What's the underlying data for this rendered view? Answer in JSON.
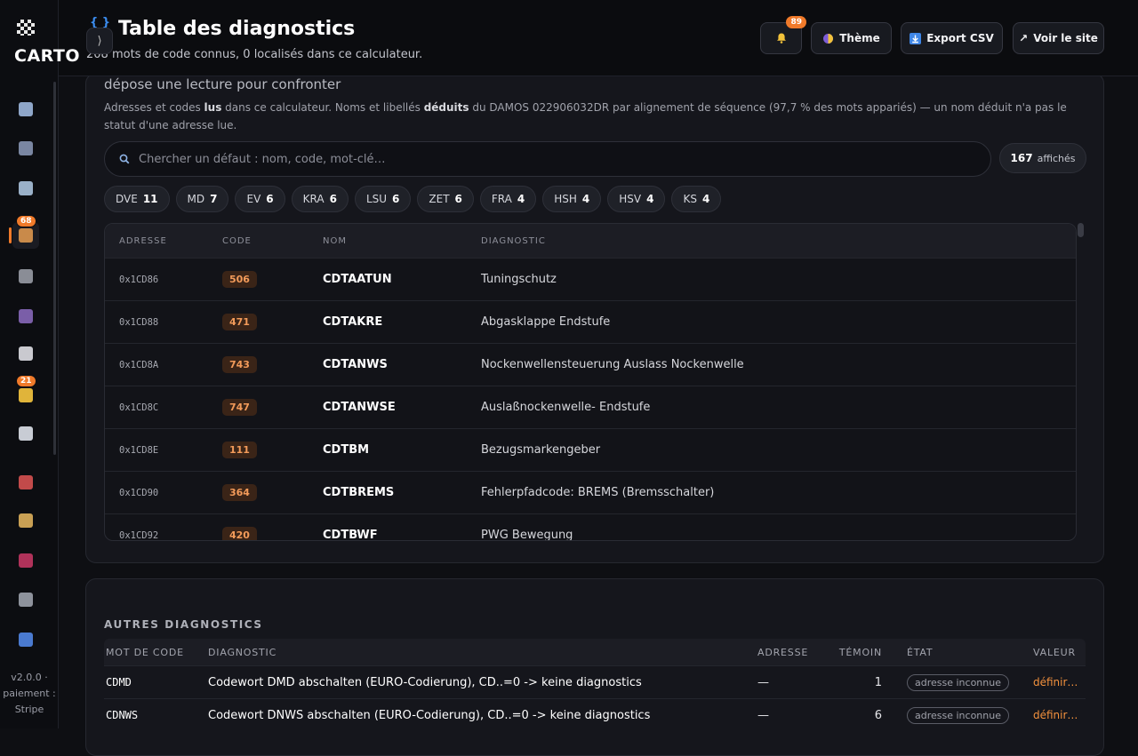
{
  "sidebar": {
    "brand": "CARTO",
    "version_text": "v2.0.0 · paiement : Stripe",
    "items": [
      {
        "icon": "bar-chart-icon",
        "color": "#8fa6c9"
      },
      {
        "icon": "tv-icon",
        "color": "#7a86a2"
      },
      {
        "icon": "trend-chart-icon",
        "color": "#9ab0c8"
      },
      {
        "icon": "package-icon",
        "color": "#c98a4a",
        "badge": "68",
        "active": true
      },
      {
        "icon": "plug-icon",
        "color": "#8a8d96"
      },
      {
        "icon": "users-icon",
        "color": "#7a5ea8"
      },
      {
        "icon": "chat-icon",
        "color": "#c9c9cf"
      },
      {
        "icon": "star-icon",
        "color": "#e0b43a",
        "badge": "21"
      },
      {
        "icon": "robot-icon",
        "color": "#c8ccd4"
      },
      {
        "icon": "car-icon",
        "color": "#c24a4a"
      },
      {
        "icon": "tag-icon",
        "color": "#c9a054"
      },
      {
        "icon": "ticket-icon",
        "color": "#b0325a"
      },
      {
        "icon": "building-icon",
        "color": "#8e929c"
      },
      {
        "icon": "shield-icon",
        "color": "#4a7ad0"
      }
    ]
  },
  "header": {
    "title": "Table des diagnostics",
    "subtitle": "208 mots de code connus, 0 localisés dans ce calculateur.",
    "notif_count": "89",
    "theme_label": "Thème",
    "export_label": "Export CSV",
    "site_label": "Voir le site"
  },
  "panel1": {
    "lead": "dépose une lecture pour confronter",
    "desc": {
      "p1": "Adresses et codes ",
      "b1": "lus",
      "p2": " dans ce calculateur. Noms et libellés ",
      "b2": "déduits",
      "p3": " du DAMOS 022906032DR par alignement de séquence (97,7 % des mots appariés) — un nom déduit n'a pas le statut d'une adresse lue."
    },
    "search_placeholder": "Chercher un défaut : nom, code, mot-clé…",
    "count_value": "167",
    "count_label": "affichés",
    "chips": [
      {
        "label": "DVE",
        "count": "11"
      },
      {
        "label": "MD",
        "count": "7"
      },
      {
        "label": "EV",
        "count": "6"
      },
      {
        "label": "KRA",
        "count": "6"
      },
      {
        "label": "LSU",
        "count": "6"
      },
      {
        "label": "ZET",
        "count": "6"
      },
      {
        "label": "FRA",
        "count": "4"
      },
      {
        "label": "HSH",
        "count": "4"
      },
      {
        "label": "HSV",
        "count": "4"
      },
      {
        "label": "KS",
        "count": "4"
      }
    ],
    "columns": [
      "ADRESSE",
      "CODE",
      "NOM",
      "DIAGNOSTIC"
    ],
    "rows": [
      {
        "adresse": "0x1CD86",
        "code": "506",
        "nom": "CDTAATUN",
        "diagnostic": "Tuningschutz"
      },
      {
        "adresse": "0x1CD88",
        "code": "471",
        "nom": "CDTAKRE",
        "diagnostic": "Abgasklappe Endstufe"
      },
      {
        "adresse": "0x1CD8A",
        "code": "743",
        "nom": "CDTANWS",
        "diagnostic": "Nockenwellensteuerung Auslass Nockenwelle"
      },
      {
        "adresse": "0x1CD8C",
        "code": "747",
        "nom": "CDTANWSE",
        "diagnostic": "Auslaßnockenwelle- Endstufe"
      },
      {
        "adresse": "0x1CD8E",
        "code": "111",
        "nom": "CDTBM",
        "diagnostic": "Bezugsmarkengeber"
      },
      {
        "adresse": "0x1CD90",
        "code": "364",
        "nom": "CDTBREMS",
        "diagnostic": "Fehlerpfadcode: BREMS (Bremsschalter)"
      },
      {
        "adresse": "0x1CD92",
        "code": "420",
        "nom": "CDTBWF",
        "diagnostic": "PWG Bewegung"
      }
    ]
  },
  "panel2": {
    "title": "AUTRES DIAGNOSTICS",
    "columns": [
      "MOT DE CODE",
      "DIAGNOSTIC",
      "ADRESSE",
      "TÉMOIN",
      "ÉTAT",
      "VALEUR"
    ],
    "rows": [
      {
        "mot": "CDMD",
        "diagnostic": "Codewort DMD abschalten (EURO-Codierung), CD..=0 -> keine diagnostics",
        "adresse": "—",
        "temoin": "1",
        "etat": "adresse inconnue",
        "valeur": "définir…"
      },
      {
        "mot": "CDNWS",
        "diagnostic": "Codewort DNWS abschalten (EURO-Codierung), CD..=0 -> keine diagnostics",
        "adresse": "—",
        "temoin": "6",
        "etat": "adresse inconnue",
        "valeur": "définir…"
      }
    ]
  }
}
